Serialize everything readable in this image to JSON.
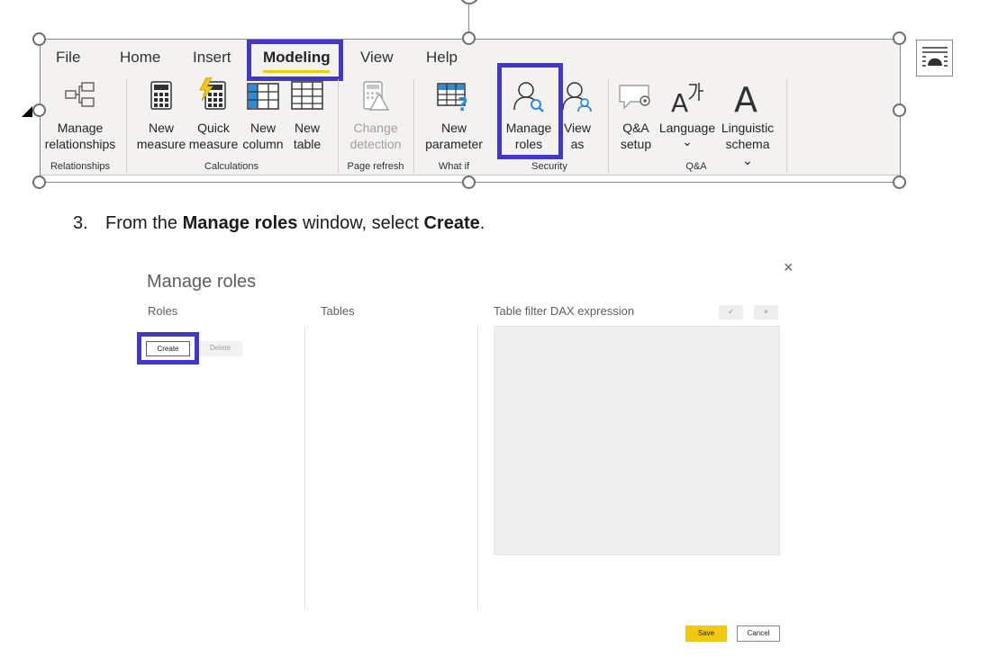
{
  "ribbon": {
    "tabs": [
      "File",
      "Home",
      "Insert",
      "Modeling",
      "View",
      "Help"
    ],
    "active_tab": "Modeling",
    "buttons": {
      "manage_relationships": [
        "Manage",
        "relationships"
      ],
      "new_measure": [
        "New",
        "measure"
      ],
      "quick_measure": [
        "Quick",
        "measure"
      ],
      "new_column": [
        "New",
        "column"
      ],
      "new_table": [
        "New",
        "table"
      ],
      "change_detection": [
        "Change",
        "detection"
      ],
      "new_parameter": [
        "New",
        "parameter"
      ],
      "manage_roles": [
        "Manage",
        "roles"
      ],
      "view_as": [
        "View",
        "as"
      ],
      "qa_setup": [
        "Q&A",
        "setup"
      ],
      "language": [
        "Language",
        "⌄"
      ],
      "linguistic_schema": [
        "Linguistic",
        "schema ⌄"
      ]
    },
    "groups": [
      "Relationships",
      "Calculations",
      "Page refresh",
      "What if",
      "Security",
      "Q&A"
    ]
  },
  "step": {
    "number": "3.",
    "prefix": "From the ",
    "bold1": "Manage roles",
    "middle": " window, select ",
    "bold2": "Create",
    "suffix": "."
  },
  "dialog": {
    "title": "Manage roles",
    "close": "×",
    "columns": [
      "Roles",
      "Tables",
      "Table filter DAX expression"
    ],
    "create_label": "Create",
    "delete_label": "Delete",
    "confirm_glyph": "✓",
    "cancel_glyph": "×",
    "save_label": "Save",
    "cancel_label": "Cancel"
  },
  "colors": {
    "highlight": "#4338c6",
    "accent_yellow": "#f2c811",
    "ribbon_bg": "#f3f2f1"
  }
}
